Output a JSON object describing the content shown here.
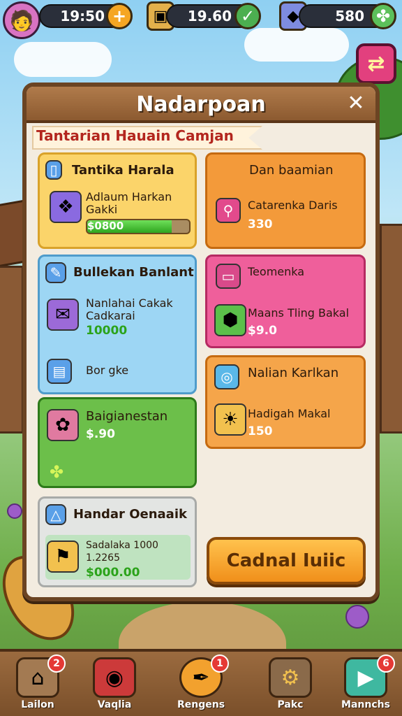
{
  "topbar": {
    "resources": [
      {
        "value": "19:50",
        "icon": "plus-icon"
      },
      {
        "value": "19.60",
        "icon": "crate-icon"
      },
      {
        "value": "580",
        "icon": "gem-icon"
      }
    ]
  },
  "panel": {
    "title": "Nadarpoan",
    "ribbon": "Tantarian Hauain Camjan"
  },
  "cards": {
    "yellow": {
      "title": "Tantika Harala",
      "item": "Adlaum Harkan Gakki",
      "price": "$0800",
      "progress": 0.83
    },
    "orange1": {
      "title": "Dan baamian",
      "item": "Catarenka Daris",
      "price": "330"
    },
    "blue": {
      "title": "Bullekan Banlant",
      "item": "Nanlahai Cakak Cadkarai",
      "price": "10000",
      "sub": "Bor gke"
    },
    "pink": {
      "title": "Teomenka",
      "item": "Maans Tling Bakal",
      "price": "$9.0"
    },
    "green": {
      "title": "Baigianestan",
      "price": "$.90"
    },
    "orange2": {
      "title": "Nalian Karlkan",
      "item": "Hadigah Makal",
      "price": "150"
    },
    "gray": {
      "title": "Handar Oenaaik",
      "item": "Sadalaka 1000 1.2265",
      "price": "$000.00"
    }
  },
  "buy_button": "Cadnal Iuiic",
  "bottom_nav": [
    {
      "label": "Lailon",
      "badge": "2",
      "icon": "house-icon"
    },
    {
      "label": "Vaqlia",
      "badge": "",
      "icon": "target-icon"
    },
    {
      "label": "Rengens",
      "badge": "1",
      "icon": "feather-icon"
    },
    {
      "label": "Pakc",
      "badge": "",
      "icon": "gear-icon"
    },
    {
      "label": "Mannchs",
      "badge": "6",
      "icon": "play-icon"
    }
  ],
  "colors": {
    "panel_border": "#6b4423",
    "yellow_card": "#fbd46a",
    "orange_card": "#f39a3a",
    "blue_card": "#9dd6f4",
    "pink_card": "#ef5f9b",
    "green_card": "#6cbf4a",
    "gray_card": "#e3e5e3",
    "price_green": "#2ba31a"
  }
}
